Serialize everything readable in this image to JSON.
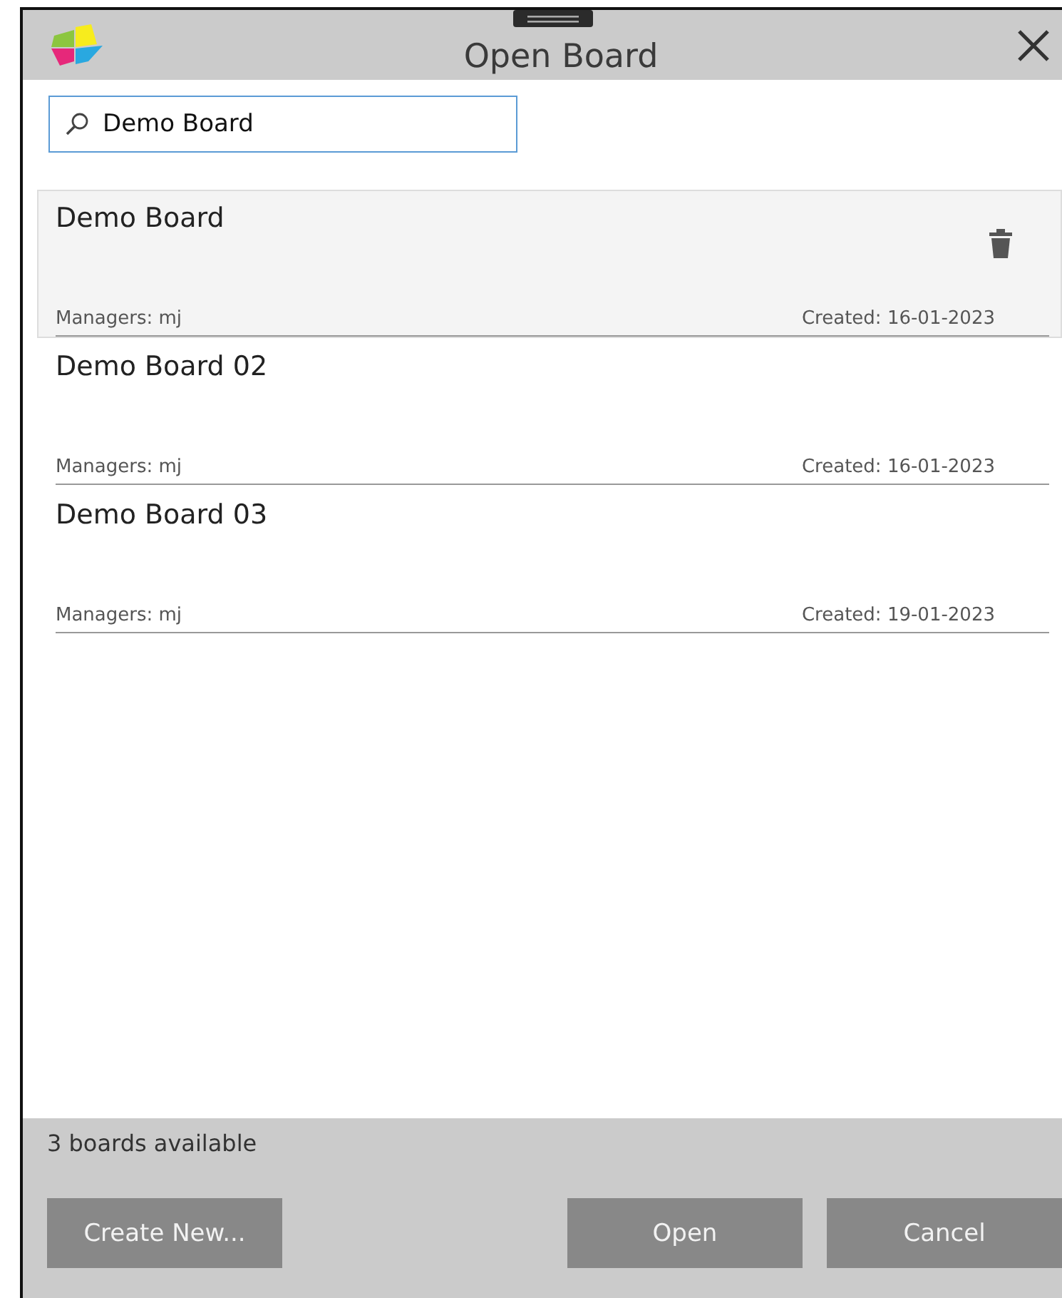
{
  "window": {
    "title": "Open Board"
  },
  "search": {
    "value": "Demo Board"
  },
  "boards": [
    {
      "name": "Demo Board",
      "managers": "Managers: mj",
      "created": "Created: 16-01-2023",
      "selected": true
    },
    {
      "name": "Demo Board 02",
      "managers": "Managers: mj",
      "created": "Created: 16-01-2023",
      "selected": false
    },
    {
      "name": "Demo Board 03",
      "managers": "Managers: mj",
      "created": "Created: 19-01-2023",
      "selected": false
    }
  ],
  "status_bar": "3 boards available",
  "buttons": {
    "left": [
      "Create New..."
    ],
    "right": [
      "Open",
      "Cancel"
    ]
  }
}
